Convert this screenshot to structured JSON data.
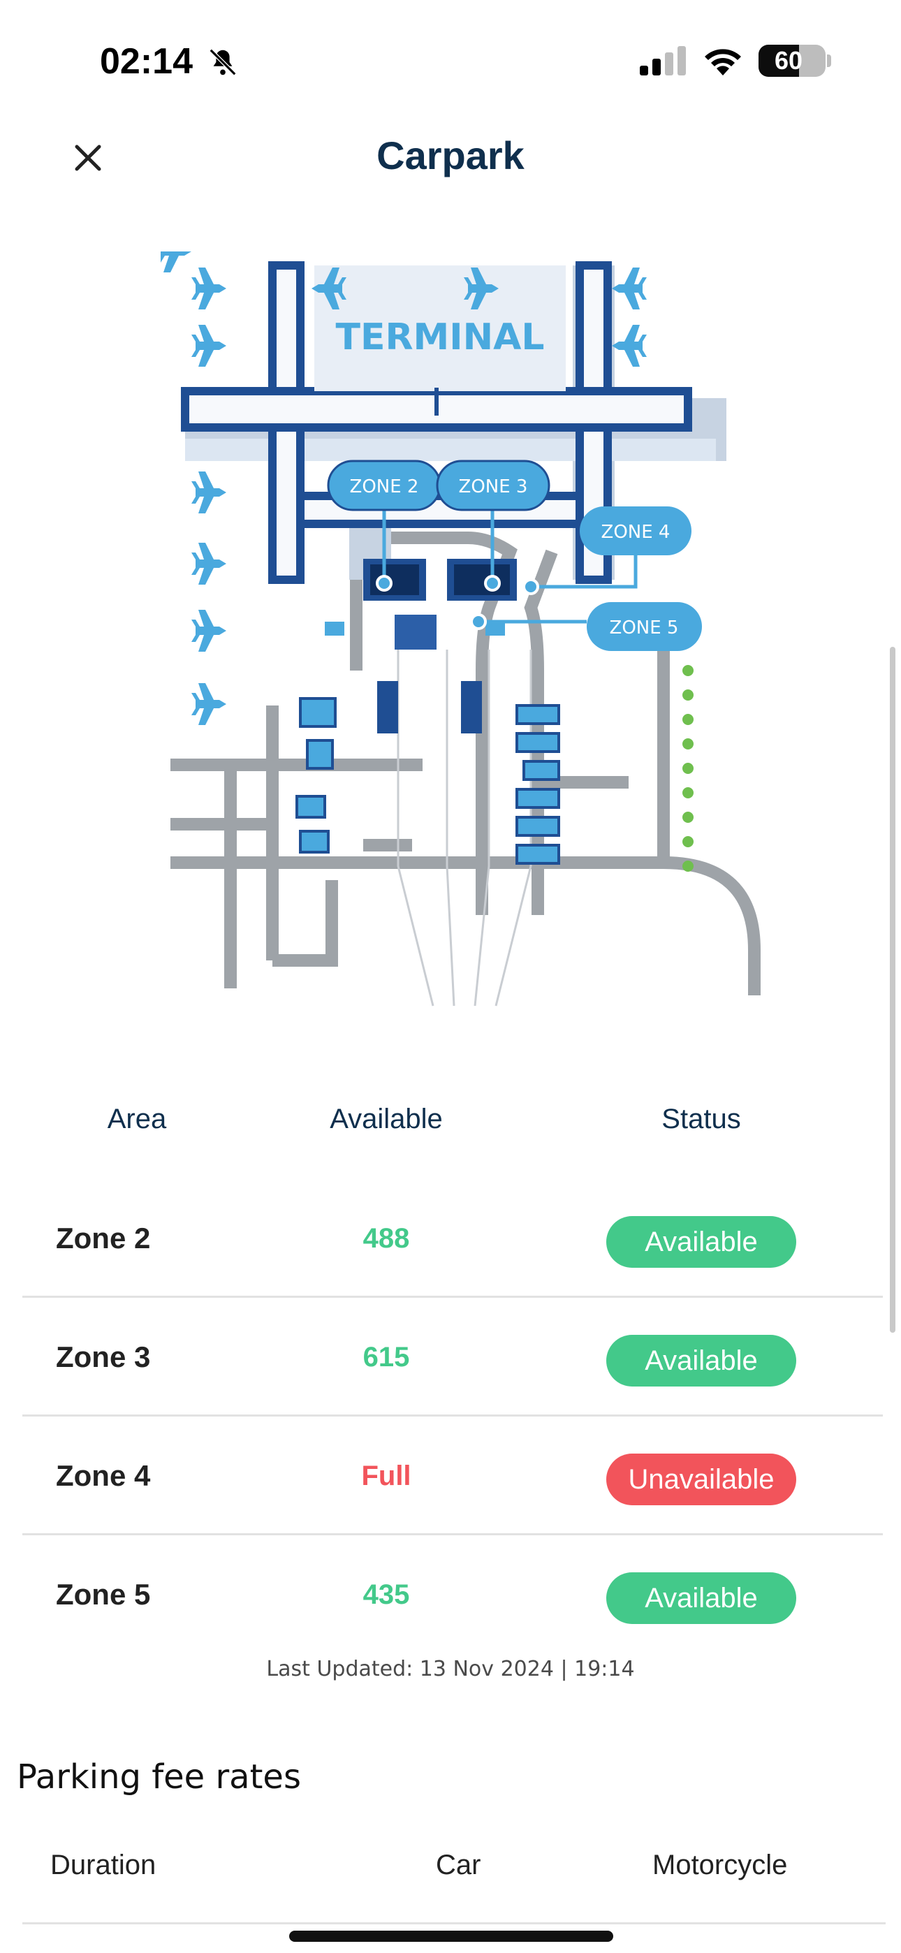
{
  "status_bar": {
    "time": "02:14",
    "battery": "60",
    "battery_level_percent": 60,
    "icons": [
      "bell-slash-icon",
      "signal-icon",
      "wifi-icon",
      "battery-icon"
    ]
  },
  "header": {
    "title": "Carpark",
    "close_icon": "close-icon"
  },
  "map": {
    "terminal_label": "TERMINAL",
    "zone_labels": [
      "ZONE 2",
      "ZONE 3",
      "ZONE 4",
      "ZONE 5"
    ]
  },
  "availability": {
    "columns": [
      "Area",
      "Available",
      "Status"
    ],
    "rows": [
      {
        "area": "Zone 2",
        "available": "488",
        "status": "Available"
      },
      {
        "area": "Zone 3",
        "available": "615",
        "status": "Available"
      },
      {
        "area": "Zone 4",
        "available": "Full",
        "status": "Unavailable"
      },
      {
        "area": "Zone 5",
        "available": "435",
        "status": "Available"
      }
    ],
    "last_updated": "Last Updated: 13 Nov 2024 | 19:14"
  },
  "fees": {
    "heading": "Parking fee rates",
    "columns": [
      "Duration",
      "Car",
      "Motorcycle"
    ]
  },
  "colors": {
    "title": "#0f2f4d",
    "available": "#43c98a",
    "unavailable": "#f2545b",
    "map_blue": "#1f4e93",
    "map_light_blue": "#4aa9de",
    "road_gray": "#9ea3a8"
  }
}
